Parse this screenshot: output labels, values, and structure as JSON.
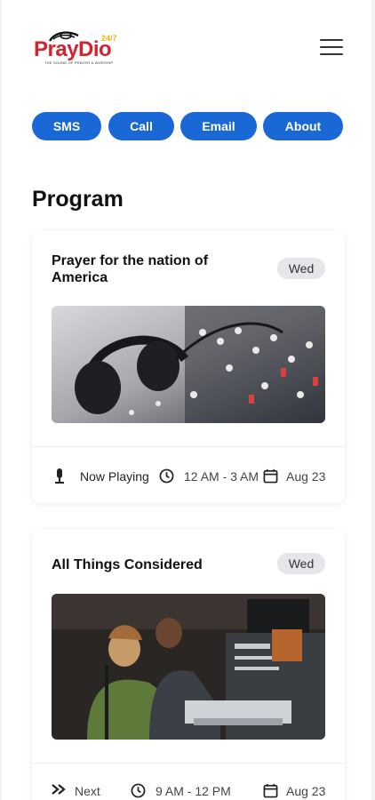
{
  "brand": {
    "logo_text": "PrayDio",
    "badge_text": "24/7",
    "tagline": "THE SOUND OF PRAYER & WORSHIP",
    "colors": {
      "logo_red": "#d3232f",
      "accent_blue": "#1a68d6",
      "badge_gold": "#f2b01e"
    }
  },
  "header": {
    "menu_icon": "hamburger-menu-icon"
  },
  "actions": {
    "sms_label": "SMS",
    "call_label": "Call",
    "email_label": "Email",
    "about_label": "About"
  },
  "program": {
    "title": "Program",
    "items": [
      {
        "title": "Prayer for the nation of America",
        "day": "Wed",
        "image": "studio-headphones-mixer",
        "status_icon": "microphone-icon",
        "status": "Now Playing",
        "time": "12 AM - 3 AM",
        "date": "Aug 23"
      },
      {
        "title": "All Things Considered",
        "day": "Wed",
        "image": "radio-hosts-in-studio",
        "status_icon": "fast-forward-icon",
        "status": "Next",
        "time": "9 AM - 12 PM",
        "date": "Aug 23"
      }
    ]
  }
}
